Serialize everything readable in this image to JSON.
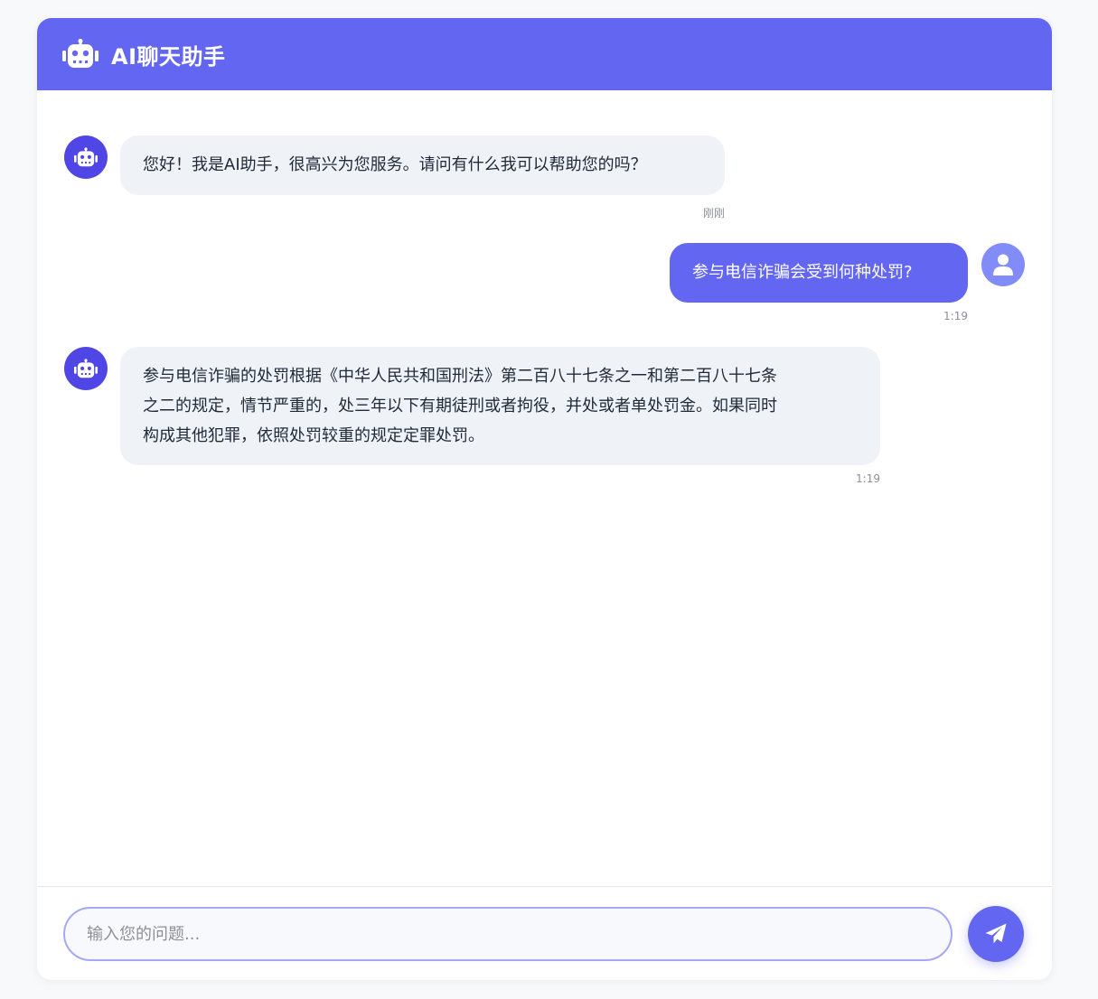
{
  "header": {
    "title": "AI聊天助手",
    "icon": "robot-icon"
  },
  "colors": {
    "accent": "#6366f1",
    "bot_avatar": "#4f46e5",
    "user_avatar": "#818cf8",
    "bot_bubble": "#eff2f7"
  },
  "messages": [
    {
      "role": "bot",
      "text": "您好！我是AI助手，很高兴为您服务。请问有什么我可以帮助您的吗？",
      "time": "刚刚"
    },
    {
      "role": "user",
      "text": "参与电信诈骗会受到何种处罚?",
      "time": "1:19"
    },
    {
      "role": "bot",
      "lines": [
        "参与电信诈骗的处罚根据《中华人民共和国刑法》第二百八十七条之一和第二百八十七条",
        "之二的规定，情节严重的，处三年以下有期徒刑或者拘役，并处或者单处罚金。如果同时",
        "构成其他犯罪，依照处罚较重的规定定罪处罚。"
      ],
      "time": "1:19"
    }
  ],
  "composer": {
    "placeholder": "输入您的问题...",
    "value": "",
    "send_icon": "paper-plane-icon"
  }
}
